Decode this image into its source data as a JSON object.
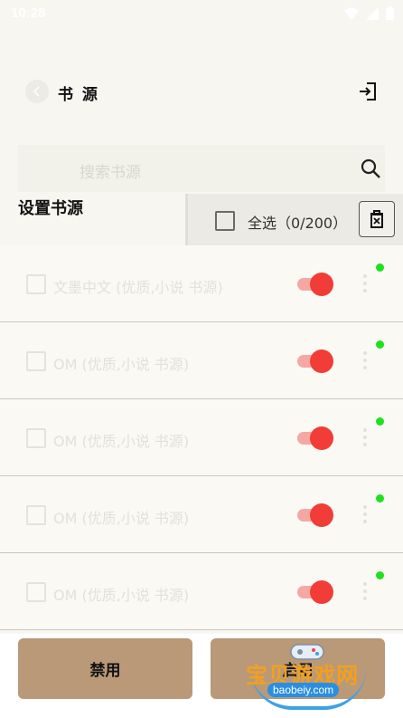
{
  "status_bar": {
    "time": "10:28"
  },
  "app_bar": {
    "title": "书 源"
  },
  "search": {
    "placeholder": "搜索书源"
  },
  "section": {
    "title": "设置书源"
  },
  "selection": {
    "select_all_label": "全选（0/200）"
  },
  "sources": [
    {
      "name": "文墨中文 (优质,小说 书源)",
      "enabled": true,
      "online": true
    },
    {
      "name": "OM (优质,小说 书源)",
      "enabled": true,
      "online": true
    },
    {
      "name": "OM (优质,小说 书源)",
      "enabled": true,
      "online": true
    },
    {
      "name": "OM (优质,小说 书源)",
      "enabled": true,
      "online": true
    },
    {
      "name": "OM (优质,小说 书源)",
      "enabled": true,
      "online": true
    }
  ],
  "actions": {
    "disable_label": "禁用",
    "enable_label": "启用"
  },
  "watermark": {
    "text": "宝贝游戏网",
    "url": "baobeiy.com"
  },
  "colors": {
    "background": "#f7f6f0",
    "button": "#b99978",
    "toggle_on": "#f23c37",
    "online_dot": "#1de21d"
  },
  "icons": [
    "back-arrow-icon",
    "import-icon",
    "search-icon",
    "delete-icon",
    "more-vert-icon",
    "wifi-icon",
    "signal-icon",
    "battery-icon"
  ]
}
